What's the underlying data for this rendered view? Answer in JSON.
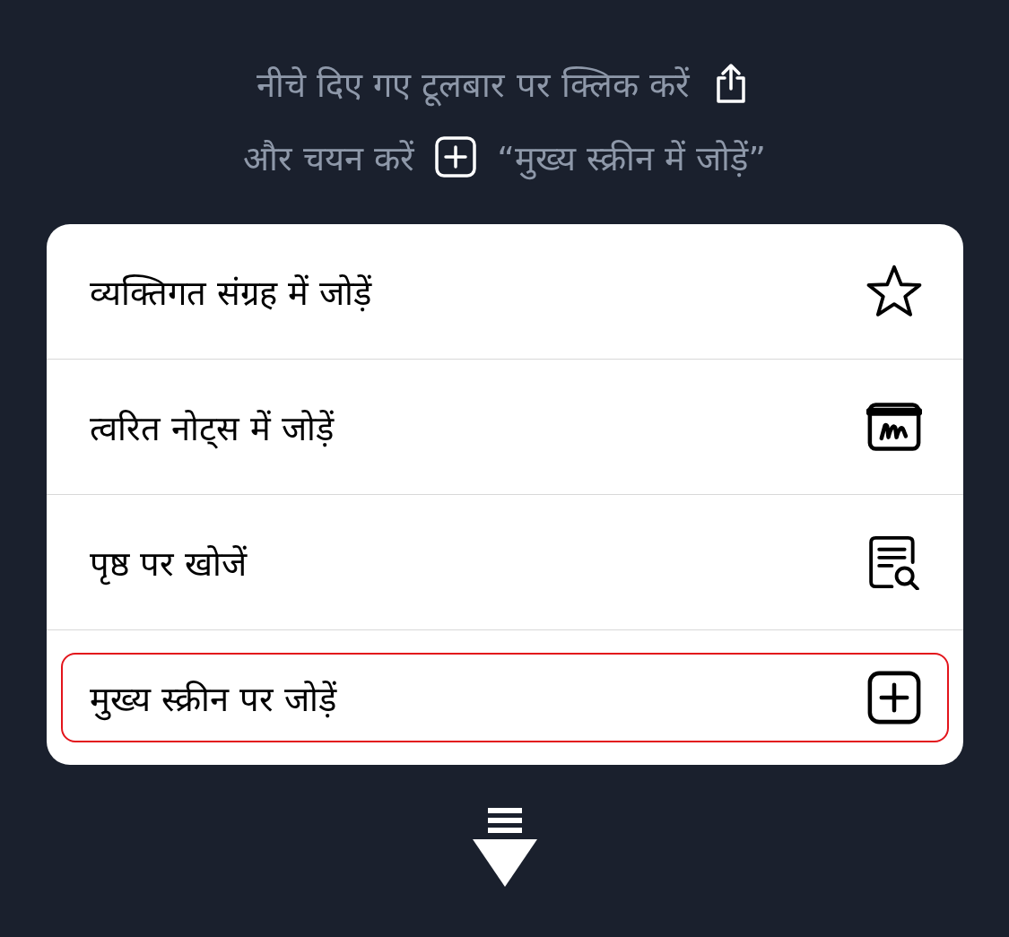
{
  "instructions": [
    {
      "before": "नीचे दिए गए टूलबार पर क्लिक करें",
      "kind": "share"
    },
    {
      "before": "और चयन करें",
      "kind": "add",
      "after": "“मुख्य स्क्रीन में जोड़ें”"
    }
  ],
  "menu": [
    {
      "label": "व्यक्तिगत संग्रह में जोड़ें",
      "kind": "star",
      "highlighted": false
    },
    {
      "label": "त्वरित नोट्स में जोड़ें",
      "kind": "note",
      "highlighted": false
    },
    {
      "label": "पृष्ठ पर खोजें",
      "kind": "find",
      "highlighted": false
    },
    {
      "label": "मुख्य स्क्रीन पर जोड़ें",
      "kind": "add",
      "highlighted": true
    }
  ]
}
